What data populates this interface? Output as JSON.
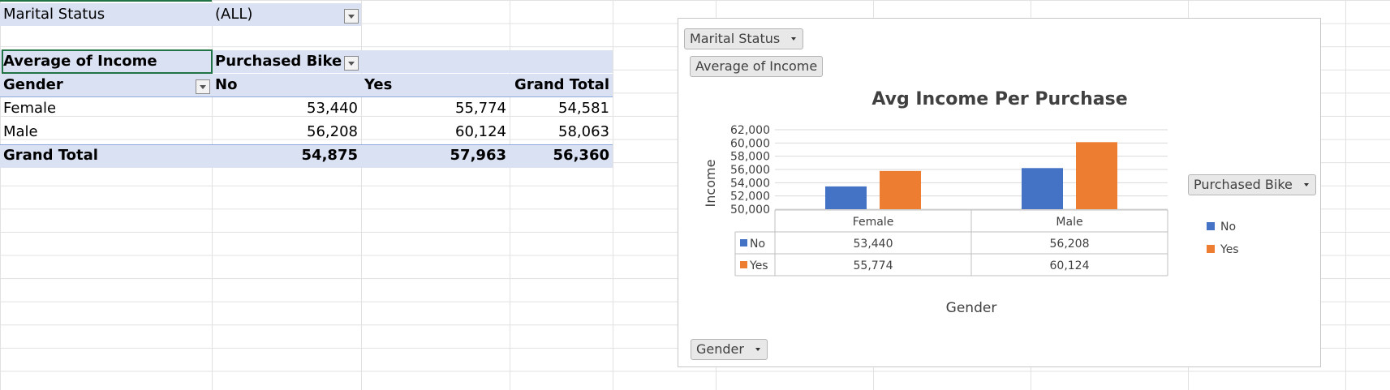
{
  "pivot": {
    "filter": {
      "label": "Marital Status",
      "value": "(ALL)"
    },
    "header": {
      "value_label": "Average of Income",
      "col_field": "Purchased Bike"
    },
    "col_headers": {
      "row_field": "Gender",
      "no": "No",
      "yes": "Yes",
      "total": "Grand Total"
    },
    "rows": [
      {
        "label": "Female",
        "no": "53,440",
        "yes": "55,774",
        "total": "54,581"
      },
      {
        "label": "Male",
        "no": "56,208",
        "yes": "60,124",
        "total": "58,063"
      }
    ],
    "grand_total": {
      "label": "Grand Total",
      "no": "54,875",
      "yes": "57,963",
      "total": "56,360"
    }
  },
  "chart": {
    "field_buttons": {
      "marital_status": "Marital Status",
      "average_income": "Average of Income",
      "purchased_bike": "Purchased Bike",
      "gender": "Gender"
    },
    "legend": [
      "No",
      "Yes"
    ]
  },
  "colors": {
    "no": "#4472c4",
    "yes": "#ed7d31",
    "header_band": "#d9e1f2",
    "selection": "#217346"
  },
  "chart_data": {
    "type": "bar",
    "title": "Avg Income Per Purchase",
    "xlabel": "Gender",
    "ylabel": "Income",
    "categories": [
      "Female",
      "Male"
    ],
    "series": [
      {
        "name": "No",
        "values": [
          53440,
          56208
        ],
        "labels": [
          "53,440",
          "56,208"
        ]
      },
      {
        "name": "Yes",
        "values": [
          55774,
          60124
        ],
        "labels": [
          "55,774",
          "60,124"
        ]
      }
    ],
    "ylim": [
      50000,
      62000
    ],
    "yticks": [
      50000,
      52000,
      54000,
      56000,
      58000,
      60000,
      62000
    ],
    "ytick_labels": [
      "50,000",
      "52,000",
      "54,000",
      "56,000",
      "58,000",
      "60,000",
      "62,000"
    ],
    "grid": true,
    "legend_position": "right",
    "data_table": true
  }
}
